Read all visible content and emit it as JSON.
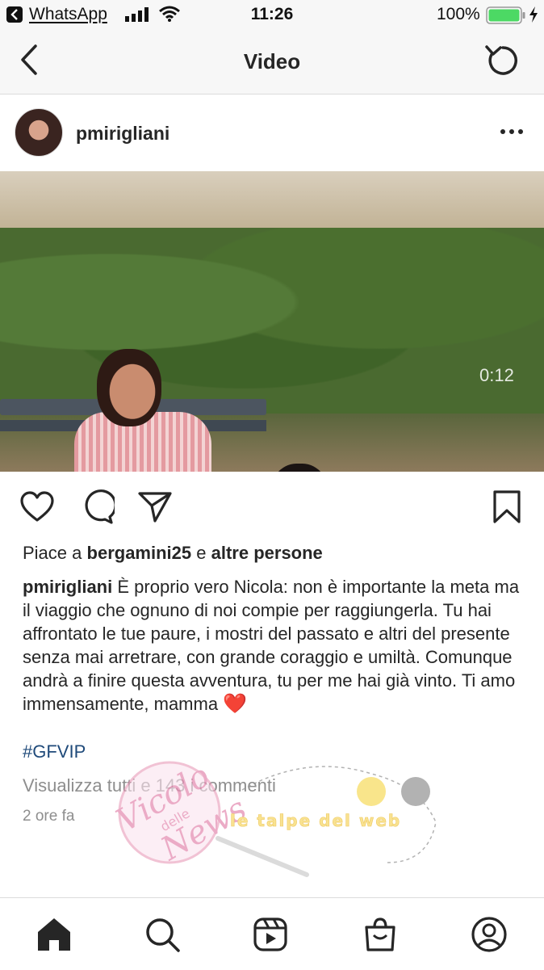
{
  "status_bar": {
    "back_app": "WhatsApp",
    "time": "11:26",
    "battery_percent": "100%",
    "battery_level": 1.0,
    "battery_color": "#4cd964",
    "icons": [
      "back-to-app-icon",
      "signal-icon",
      "wifi-icon",
      "battery-icon",
      "charging-icon"
    ]
  },
  "header": {
    "title": "Video",
    "icons": [
      "back-arrow-icon",
      "refresh-icon"
    ]
  },
  "post": {
    "username": "pmirigliani",
    "video_time": "0:12",
    "likes_prefix": "Piace a",
    "likes_user": "bergamini25",
    "likes_joiner": "e",
    "likes_others": "altre persone",
    "caption_user": "pmirigliani",
    "caption_text": "È proprio vero Nicola: non è importante la meta ma il viaggio che ognuno di noi compie per raggiungerla. Tu hai affrontato le tue paure, i mostri del passato e altri del presente senza mai arretrare, con grande coraggio e umiltà. Comunque andrà a finire questa avventura, tu per me hai già vinto. Ti amo immensamente, mamma",
    "caption_emoji": "❤️",
    "hashtag": "#GFVIP",
    "view_comments": "Visualizza tutti e 143 i commenti",
    "time_ago": "2 ore fa"
  },
  "watermark": {
    "line1": "Vicolo",
    "line2": "delle",
    "line3": "News",
    "tagline": "le talpe del web"
  },
  "tab_bar": {
    "icons": [
      "home-icon",
      "search-icon",
      "reels-icon",
      "shop-icon",
      "profile-icon"
    ]
  },
  "colors": {
    "hashtag": "#1f4a7a",
    "heart": "#e0152b",
    "muted_text": "#8e8e8e"
  }
}
